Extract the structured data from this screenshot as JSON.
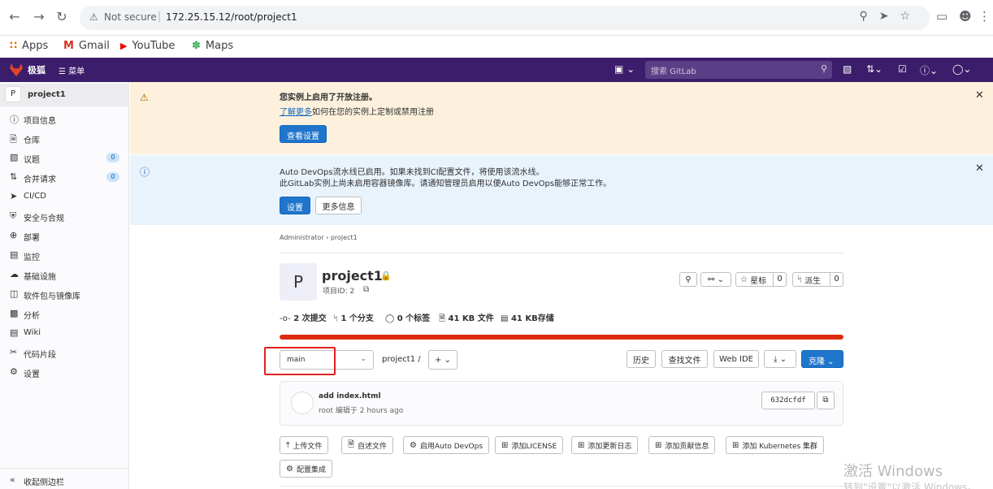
{
  "browser": {
    "url_secure_label": "Not secure",
    "url": "172.25.15.12/root/project1",
    "bookmarks": [
      {
        "icon": "apps-grid-icon",
        "label": "Apps"
      },
      {
        "icon": "gmail-icon",
        "label": "Gmail"
      },
      {
        "icon": "youtube-icon",
        "label": "YouTube"
      },
      {
        "icon": "maps-icon",
        "label": "Maps"
      }
    ]
  },
  "header": {
    "brand": "极狐",
    "menu_label": "菜单",
    "search_placeholder": "搜索 GitLab",
    "color": "#3b1d6b"
  },
  "sidebar": {
    "project_initial": "P",
    "project_name": "project1",
    "items": [
      {
        "icon": "project-info-icon",
        "label": "项目信息"
      },
      {
        "icon": "repository-icon",
        "label": "仓库"
      },
      {
        "icon": "issues-icon",
        "label": "议题",
        "badge": "0"
      },
      {
        "icon": "merge-request-icon",
        "label": "合并请求",
        "badge": "0"
      },
      {
        "icon": "rocket-icon",
        "label": "CI/CD"
      },
      {
        "icon": "shield-icon",
        "label": "安全与合规"
      },
      {
        "icon": "deployments-icon",
        "label": "部署"
      },
      {
        "icon": "monitor-icon",
        "label": "监控"
      },
      {
        "icon": "cloud-icon",
        "label": "基础设施"
      },
      {
        "icon": "package-icon",
        "label": "软件包与镜像库"
      },
      {
        "icon": "chart-icon",
        "label": "分析"
      },
      {
        "icon": "book-icon",
        "label": "Wiki"
      },
      {
        "icon": "snippet-icon",
        "label": "代码片段"
      },
      {
        "icon": "settings-icon",
        "label": "设置"
      }
    ],
    "collapse_label": "收起侧边栏"
  },
  "alerts": {
    "registration": {
      "title": "您实例上启用了开放注册。",
      "link": "了解更多",
      "text": "如何在您的实例上定制或禁用注册",
      "button": "查看设置"
    },
    "devops": {
      "line1": "Auto DevOps流水线已启用。如果未找到CI配置文件，将使用该流水线。",
      "line2": "此GitLab实例上尚未启用容器镜像库。请通知管理员启用以便Auto DevOps能够正常工作。",
      "button_primary": "设置",
      "button_secondary": "更多信息"
    }
  },
  "breadcrumb": {
    "items": [
      "Administrator",
      "project1"
    ]
  },
  "project": {
    "initial": "P",
    "name": "project1",
    "id_label": "项目ID: 2",
    "star_label": "星标",
    "star_count": "0",
    "fork_label": "派生",
    "fork_count": "0",
    "stats": {
      "commits": "2 次提交",
      "branches": "1 个分支",
      "tags": "0 个标签",
      "files": "41 KB 文件",
      "storage": "41 KB存储"
    },
    "progress_fraction": 1.0,
    "progress_color": "#dd2b0e"
  },
  "repo": {
    "branch": "main",
    "path": "project1",
    "path_separator": "/",
    "buttons": {
      "history": "历史",
      "find_file": "查找文件",
      "web_ide": "Web IDE",
      "clone": "克隆"
    }
  },
  "commit": {
    "title": "add index.html",
    "meta": "root 编辑于 2 hours ago",
    "sha": "632dcfdf"
  },
  "quick_actions": [
    {
      "icon": "upload-icon",
      "label": "上传文件"
    },
    {
      "icon": "document-icon",
      "label": "自述文件"
    },
    {
      "icon": "gear-icon",
      "label": "启用Auto DevOps"
    },
    {
      "icon": "plus-square-icon",
      "label": "添加LICENSE"
    },
    {
      "icon": "plus-square-icon",
      "label": "添加更新日志"
    },
    {
      "icon": "plus-square-icon",
      "label": "添加贡献信息"
    },
    {
      "icon": "plus-square-icon",
      "label": "添加 Kubernetes 集群"
    },
    {
      "icon": "gear-icon",
      "label": "配置集成"
    }
  ],
  "watermark": {
    "line1": "激活 Windows",
    "line2": "转到\"设置\"以激活 Windows。"
  }
}
